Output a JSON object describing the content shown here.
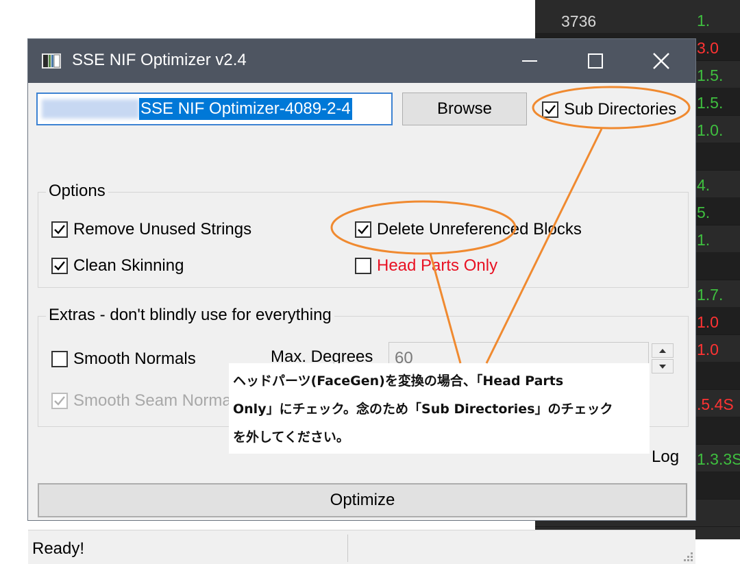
{
  "background_table": {
    "rows": [
      {
        "left": "3736",
        "right": "1.",
        "right_color": "#3fbf3f"
      },
      {
        "left": "",
        "right": "3.0",
        "right_color": "#ff3333"
      },
      {
        "left": "",
        "right": "1.5.",
        "right_color": "#3fbf3f"
      },
      {
        "left": "",
        "right": "1.5.",
        "right_color": "#3fbf3f"
      },
      {
        "left": "",
        "right": "1.0.",
        "right_color": "#3fbf3f"
      },
      {
        "left": "",
        "right": "",
        "right_color": "#3fbf3f"
      },
      {
        "left": "",
        "right": "4.",
        "right_color": "#3fbf3f"
      },
      {
        "left": "",
        "right": "5.",
        "right_color": "#3fbf3f"
      },
      {
        "left": "",
        "right": "1.",
        "right_color": "#3fbf3f"
      },
      {
        "left": "",
        "right": "",
        "right_color": "#3fbf3f"
      },
      {
        "left": "",
        "right": "1.7.",
        "right_color": "#3fbf3f"
      },
      {
        "left": "",
        "right": "1.0",
        "right_color": "#ff3333"
      },
      {
        "left": "",
        "right": "1.0",
        "right_color": "#ff3333"
      },
      {
        "left": "",
        "right": "",
        "right_color": "#3fbf3f"
      },
      {
        "left": "",
        "right": ".5.4S",
        "right_color": "#ff3333"
      },
      {
        "left": "",
        "right": "",
        "right_color": "#3fbf3f"
      },
      {
        "left": "",
        "right": "1.3.3S",
        "right_color": "#3fbf3f"
      },
      {
        "left": "",
        "right": "",
        "right_color": "#3fbf3f"
      },
      {
        "left": "",
        "right": "",
        "right_color": "#3fbf3f"
      }
    ]
  },
  "window": {
    "title": "SSE NIF Optimizer v2.4",
    "path_value": "SSE NIF Optimizer-4089-2-4",
    "browse_label": "Browse",
    "sub_directories_label": "Sub Directories",
    "sub_directories_checked": true
  },
  "options": {
    "title": "Options",
    "remove_unused_strings": "Remove Unused Strings",
    "delete_unreferenced_blocks": "Delete Unreferenced Blocks",
    "clean_skinning": "Clean Skinning",
    "head_parts_only": "Head Parts Only",
    "head_parts_only_checked": false
  },
  "extras": {
    "title": "Extras - don't blindly use for everything",
    "smooth_normals": "Smooth Normals",
    "max_degrees_label": "Max. Degrees",
    "max_degrees_value": "60",
    "smooth_seam_normals": "Smooth Seam Normals"
  },
  "log_label": "Log",
  "optimize_label": "Optimize",
  "status_text": "Ready!",
  "annotation": {
    "line1": "ヘッドパーツ(FaceGen)を変換の場合、「Head Parts",
    "line2": "Only」にチェック。念のため「Sub Directories」のチェック",
    "line3": "を外してください。"
  },
  "colors": {
    "titlebar": "#4e5561",
    "window_bg": "#f0f0f0",
    "highlight_outline": "#f08a30",
    "warning_text": "#e81123",
    "selection": "#0078d7"
  }
}
